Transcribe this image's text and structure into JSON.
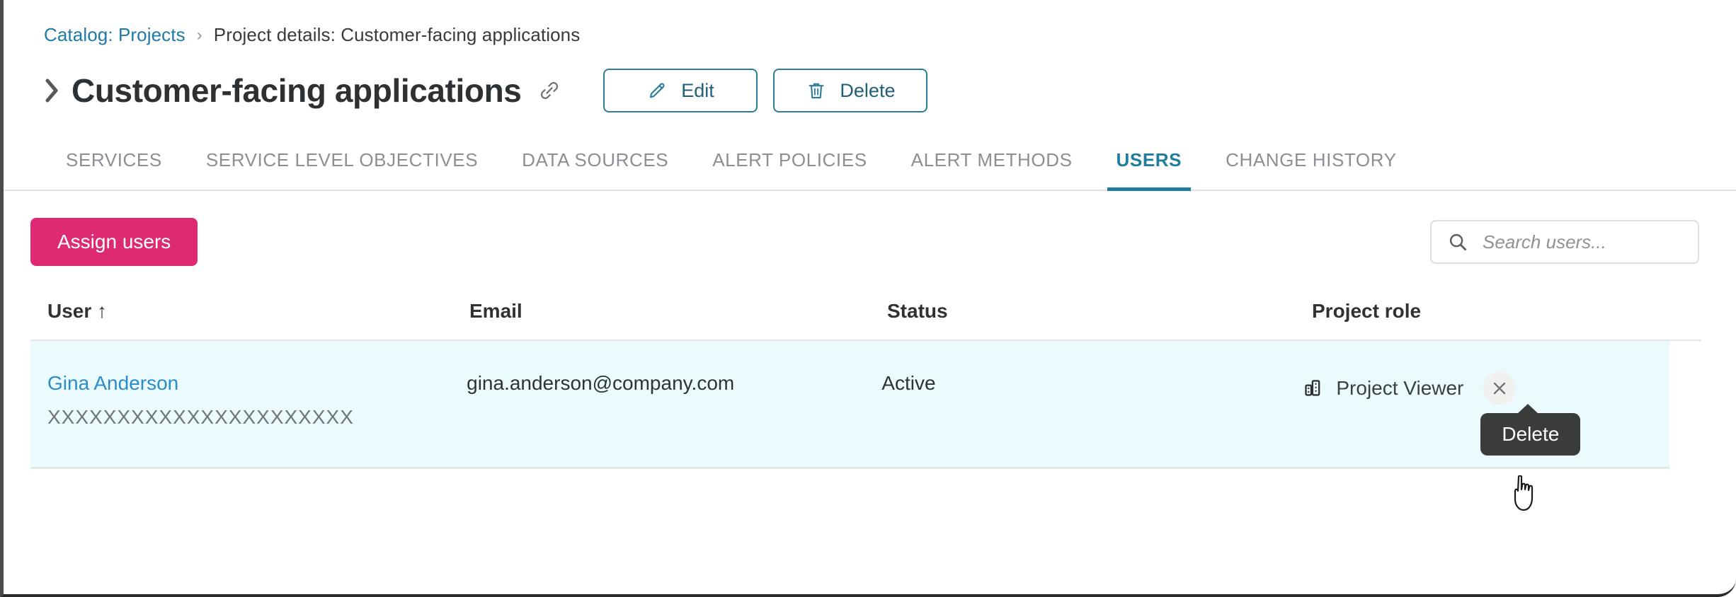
{
  "breadcrumb": {
    "link_label": "Catalog: Projects",
    "separator": "›",
    "current_label": "Project details: Customer-facing applications"
  },
  "header": {
    "title": "Customer-facing applications",
    "expand_icon": "chevron-right-icon",
    "link_icon": "link-icon",
    "edit_label": "Edit",
    "delete_label": "Delete"
  },
  "tabs": [
    {
      "label": "SERVICES",
      "active": false
    },
    {
      "label": "SERVICE LEVEL OBJECTIVES",
      "active": false
    },
    {
      "label": "DATA SOURCES",
      "active": false
    },
    {
      "label": "ALERT POLICIES",
      "active": false
    },
    {
      "label": "ALERT METHODS",
      "active": false
    },
    {
      "label": "USERS",
      "active": true
    },
    {
      "label": "CHANGE HISTORY",
      "active": false
    }
  ],
  "toolbar": {
    "assign_users_label": "Assign users",
    "search_placeholder": "Search users...",
    "search_value": "",
    "search_icon": "search-icon"
  },
  "table": {
    "columns": [
      {
        "key": "user",
        "label": "User",
        "sort_indicator": "↑"
      },
      {
        "key": "email",
        "label": "Email",
        "sort_indicator": ""
      },
      {
        "key": "status",
        "label": "Status",
        "sort_indicator": ""
      },
      {
        "key": "role",
        "label": "Project role",
        "sort_indicator": ""
      }
    ],
    "rows": [
      {
        "user_name": "Gina Anderson",
        "user_sub": "XXXXXXXXXXXXXXXXXXXXXX",
        "email": "gina.anderson@company.com",
        "status": "Active",
        "role": "Project Viewer",
        "role_icon": "organization-icon",
        "remove_icon": "close-icon"
      }
    ]
  },
  "tooltip": {
    "text": "Delete"
  },
  "colors": {
    "accent_primary": "#de2a72",
    "accent_teal": "#1f7d9e",
    "link_blue": "#2a8cc9",
    "row_highlight": "#ebfbfd",
    "tooltip_bg": "#3b3b3b",
    "button_border": "#2e7c9c"
  }
}
